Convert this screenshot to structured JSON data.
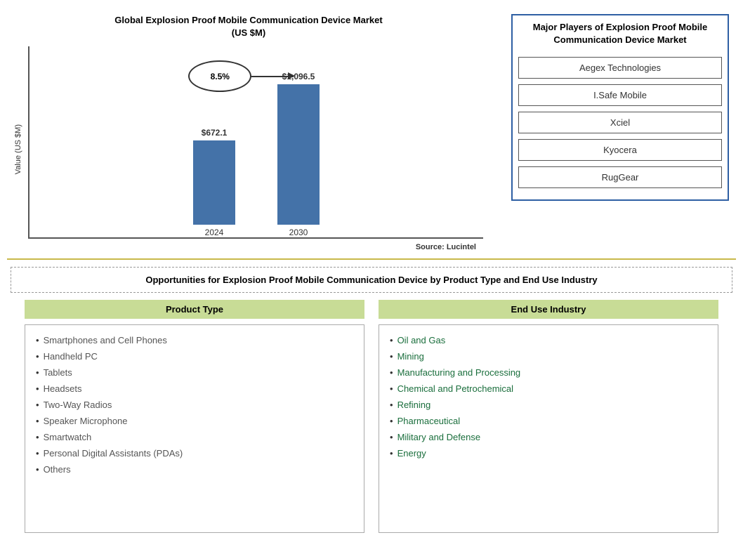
{
  "chart": {
    "title_line1": "Global Explosion Proof Mobile Communication Device Market",
    "title_line2": "(US $M)",
    "y_axis_label": "Value (US $M)",
    "bar_2024_value": "$672.1",
    "bar_2024_label": "2024",
    "bar_2030_value": "$1,096.5",
    "bar_2030_label": "2030",
    "cagr_label": "8.5%",
    "source_text": "Source: Lucintel",
    "bar_2024_height": 120,
    "bar_2030_height": 200
  },
  "major_players": {
    "title": "Major Players of Explosion Proof Mobile Communication Device Market",
    "players": [
      "Aegex Technologies",
      "I.Safe Mobile",
      "Xciel",
      "Kyocera",
      "RugGear"
    ]
  },
  "opportunities": {
    "title": "Opportunities for Explosion Proof Mobile Communication Device by Product Type and End Use Industry",
    "product_type": {
      "header": "Product Type",
      "items": [
        "Smartphones and Cell Phones",
        "Handheld PC",
        "Tablets",
        "Headsets",
        "Two-Way Radios",
        "Speaker Microphone",
        "Smartwatch",
        "Personal Digital Assistants (PDAs)",
        "Others"
      ]
    },
    "end_use": {
      "header": "End Use Industry",
      "items": [
        "Oil and Gas",
        "Mining",
        "Manufacturing and Processing",
        "Chemical and Petrochemical",
        "Refining",
        "Pharmaceutical",
        "Military and Defense",
        "Energy"
      ]
    }
  }
}
